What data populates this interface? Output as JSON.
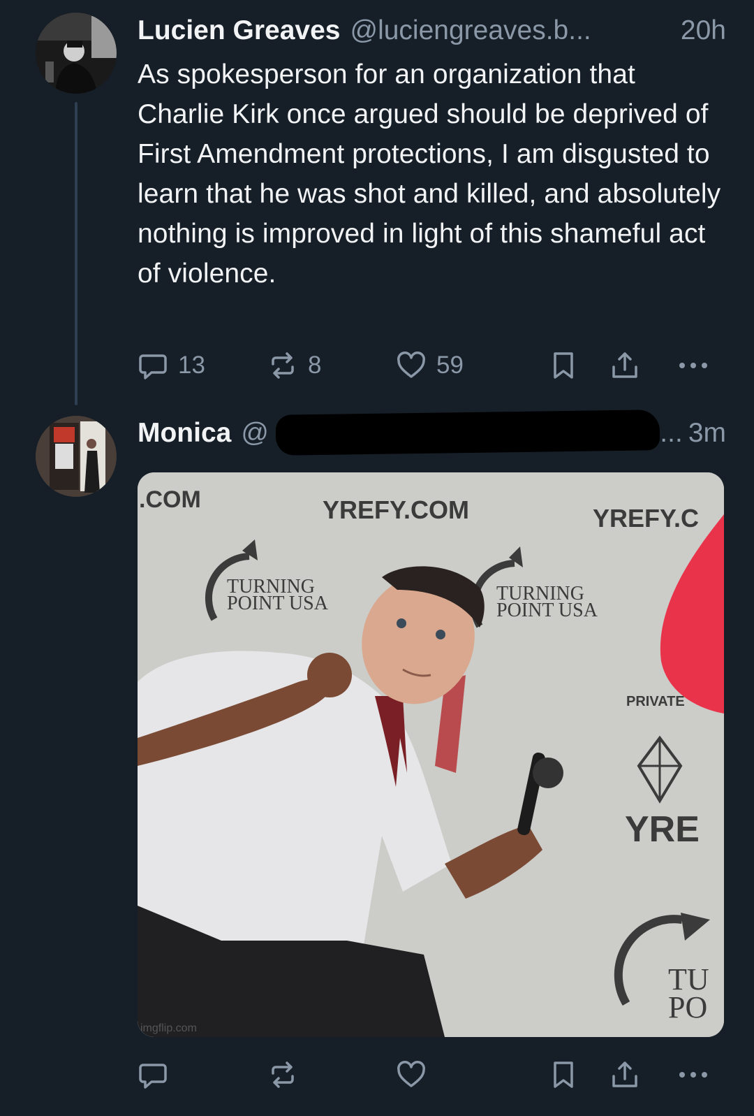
{
  "posts": [
    {
      "author": "Lucien Greaves",
      "handle": "@luciengreaves.b...",
      "time": "20h",
      "text": "As spokesperson for an organization that Charlie Kirk once argued should be deprived of First Amendment protections, I am disgusted to learn that he was shot and killed, and absolutely nothing is improved in light of this shameful act of violence.",
      "replies": "13",
      "reposts": "8",
      "likes": "59"
    },
    {
      "author": "Monica",
      "handle": "@",
      "handle_tail": "...",
      "time": "3m",
      "image_text": {
        "sponsor_1": ".COM",
        "sponsor_2": "YREFY.COM",
        "sponsor_3": "YREFY.C",
        "sponsor_4": "YRE",
        "logo_1": "TURNING",
        "logo_1b": "POINT USA",
        "logo_2": "TURNING",
        "logo_2b": "POINT USA",
        "logo_3": "TU",
        "logo_3b": "PO",
        "private": "PRIVATE",
        "watermark": "imgflip.com"
      }
    }
  ],
  "icons": {
    "reply": "speech-bubble",
    "repost": "repost-arrows",
    "like": "heart",
    "bookmark": "bookmark",
    "share": "upload-arrow",
    "more": "three-dots"
  },
  "colors": {
    "background": "#161e27",
    "text": "#f1f3f5",
    "muted": "#8b98a8",
    "thread_line": "#2e3f52"
  }
}
